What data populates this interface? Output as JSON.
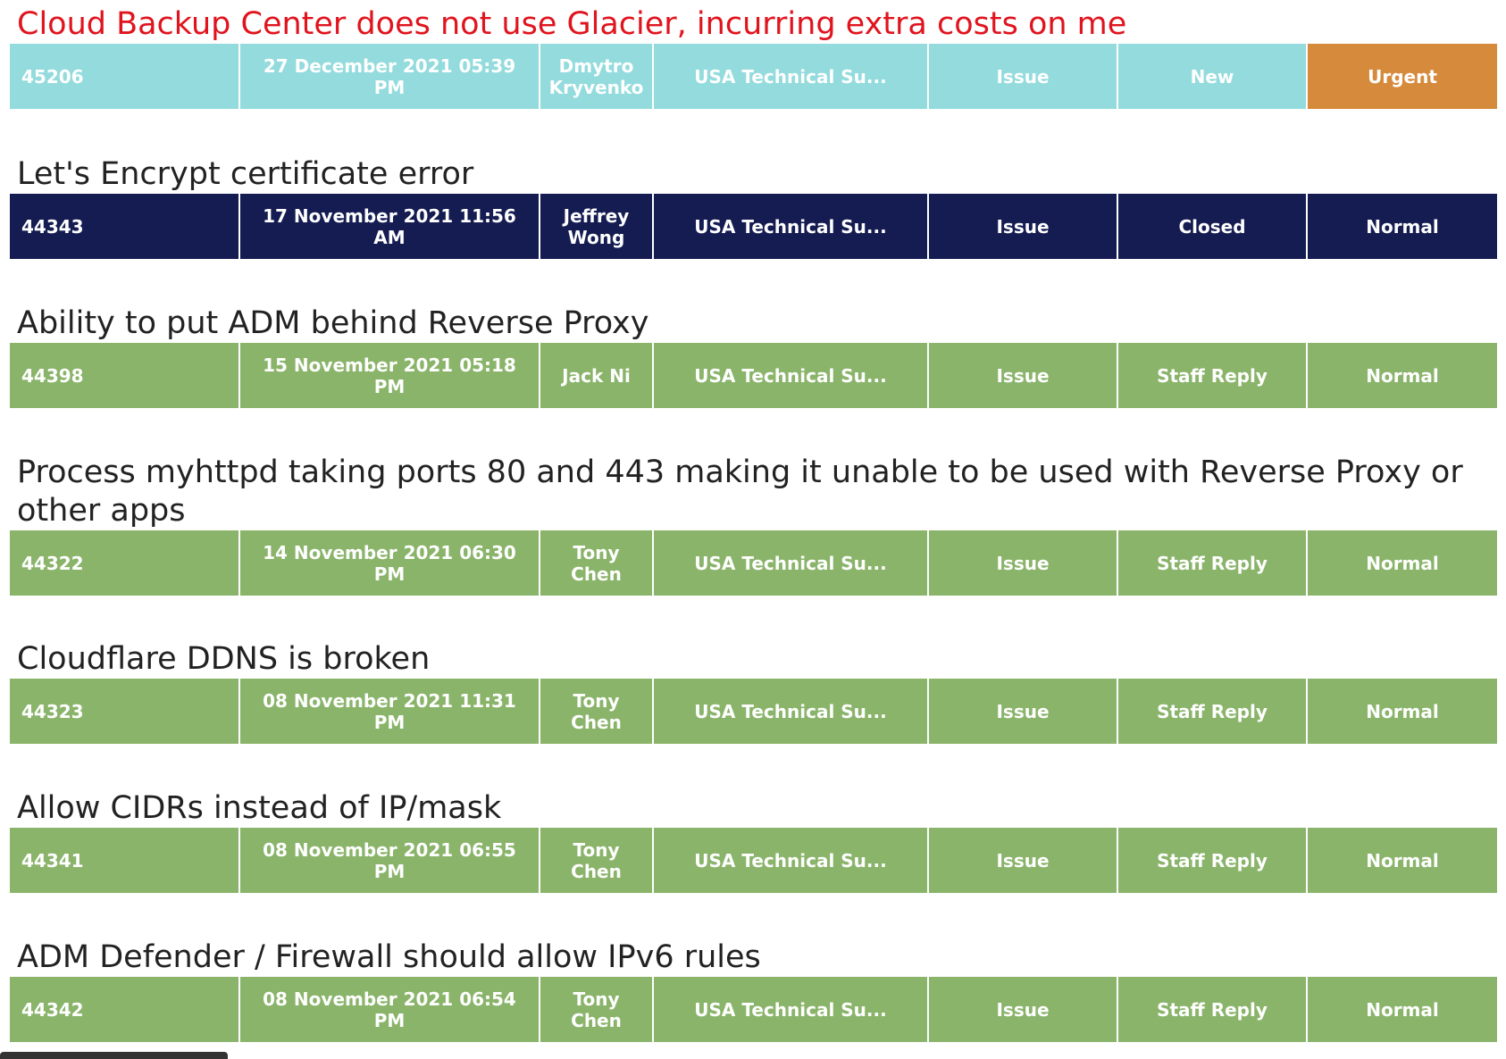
{
  "colors": {
    "teal": "#93dbdd",
    "navy": "#141c52",
    "green": "#8ab46a",
    "urgent_orange": "#d68a3c",
    "urgent_title": "#e0141e"
  },
  "tickets": [
    {
      "title": "Cloud Backup Center does not use Glacier, incurring extra costs on me",
      "id": "45206",
      "date": "27 December 2021 05:39 PM",
      "agent": "Dmytro Kryvenko",
      "department": "USA Technical Su...",
      "type": "Issue",
      "status": "New",
      "priority": "Urgent"
    },
    {
      "title": "Let's Encrypt certificate error",
      "id": "44343",
      "date": "17 November 2021 11:56 AM",
      "agent": "Jeffrey Wong",
      "department": "USA Technical Su...",
      "type": "Issue",
      "status": "Closed",
      "priority": "Normal"
    },
    {
      "title": "Ability to put ADM behind Reverse Proxy",
      "id": "44398",
      "date": "15 November 2021 05:18 PM",
      "agent": "Jack Ni",
      "department": "USA Technical Su...",
      "type": "Issue",
      "status": "Staff Reply",
      "priority": "Normal"
    },
    {
      "title": "Process myhttpd taking ports 80 and 443 making it unable to be used with Reverse Proxy or other apps",
      "id": "44322",
      "date": "14 November 2021 06:30 PM",
      "agent": "Tony Chen",
      "department": "USA Technical Su...",
      "type": "Issue",
      "status": "Staff Reply",
      "priority": "Normal"
    },
    {
      "title": "Cloudflare DDNS is broken",
      "id": "44323",
      "date": "08 November 2021 11:31 PM",
      "agent": "Tony Chen",
      "department": "USA Technical Su...",
      "type": "Issue",
      "status": "Staff Reply",
      "priority": "Normal"
    },
    {
      "title": "Allow CIDRs instead of IP/mask",
      "id": "44341",
      "date": "08 November 2021 06:55 PM",
      "agent": "Tony Chen",
      "department": "USA Technical Su...",
      "type": "Issue",
      "status": "Staff Reply",
      "priority": "Normal"
    },
    {
      "title": "ADM Defender / Firewall should allow IPv6 rules",
      "id": "44342",
      "date": "08 November 2021 06:54 PM",
      "agent": "Tony Chen",
      "department": "USA Technical Su...",
      "type": "Issue",
      "status": "Staff Reply",
      "priority": "Normal"
    }
  ]
}
